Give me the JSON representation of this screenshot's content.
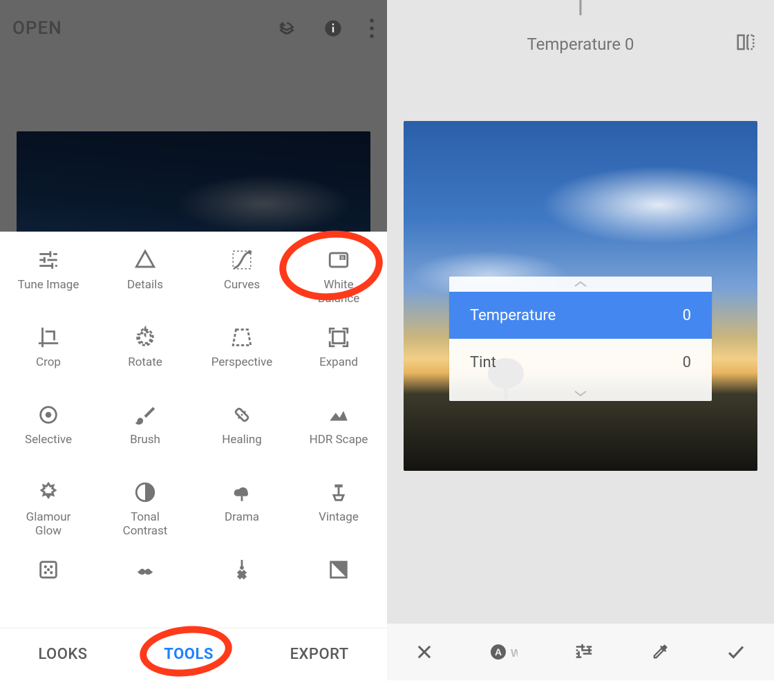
{
  "left": {
    "open_label": "OPEN",
    "tools": [
      {
        "label": "Tune Image",
        "icon": "tune"
      },
      {
        "label": "Details",
        "icon": "details"
      },
      {
        "label": "Curves",
        "icon": "curves"
      },
      {
        "label": "White\nBalance",
        "icon": "white-balance"
      },
      {
        "label": "Crop",
        "icon": "crop"
      },
      {
        "label": "Rotate",
        "icon": "rotate"
      },
      {
        "label": "Perspective",
        "icon": "perspective"
      },
      {
        "label": "Expand",
        "icon": "expand"
      },
      {
        "label": "Selective",
        "icon": "selective"
      },
      {
        "label": "Brush",
        "icon": "brush"
      },
      {
        "label": "Healing",
        "icon": "healing"
      },
      {
        "label": "HDR Scape",
        "icon": "hdr"
      },
      {
        "label": "Glamour\nGlow",
        "icon": "glamour"
      },
      {
        "label": "Tonal\nContrast",
        "icon": "tonal"
      },
      {
        "label": "Drama",
        "icon": "drama"
      },
      {
        "label": "Vintage",
        "icon": "vintage"
      }
    ],
    "last_row": [
      {
        "icon": "grunge"
      },
      {
        "icon": "mustache"
      },
      {
        "icon": "guitar"
      },
      {
        "icon": "bw"
      }
    ],
    "nav": {
      "looks": "LOOKS",
      "tools": "TOOLS",
      "export": "EXPORT",
      "active": "tools"
    },
    "annotation_targets": [
      "white-balance",
      "tools-nav"
    ]
  },
  "right": {
    "readout_label": "Temperature",
    "readout_value": "0",
    "params": [
      {
        "label": "Temperature",
        "value": "0",
        "selected": true
      },
      {
        "label": "Tint",
        "value": "0",
        "selected": false
      }
    ],
    "bottom_icons": [
      "close",
      "auto-wb",
      "tune",
      "eyedropper",
      "check"
    ]
  }
}
